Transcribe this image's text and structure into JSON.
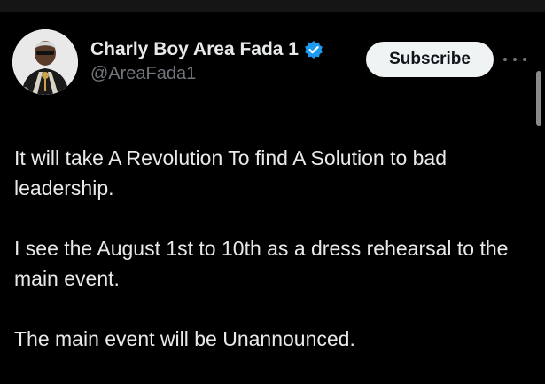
{
  "author": {
    "display_name": "Charly Boy Area Fada 1",
    "handle": "@AreaFada1",
    "verified": true,
    "avatar_icon": "user-avatar"
  },
  "actions": {
    "subscribe_label": "Subscribe",
    "more_icon": "more-horizontal-icon"
  },
  "tweet": {
    "paragraphs": [
      "It will take A Revolution To find A Solution to bad leadership.",
      "I see the August 1st to 10th as a dress rehearsal to the main event.",
      "The main event will be Unannounced."
    ]
  },
  "colors": {
    "background": "#000000",
    "text_primary": "#e7e9ea",
    "text_secondary": "#71767b",
    "verified_blue": "#1d9bf0",
    "button_bg": "#eff3f4"
  }
}
